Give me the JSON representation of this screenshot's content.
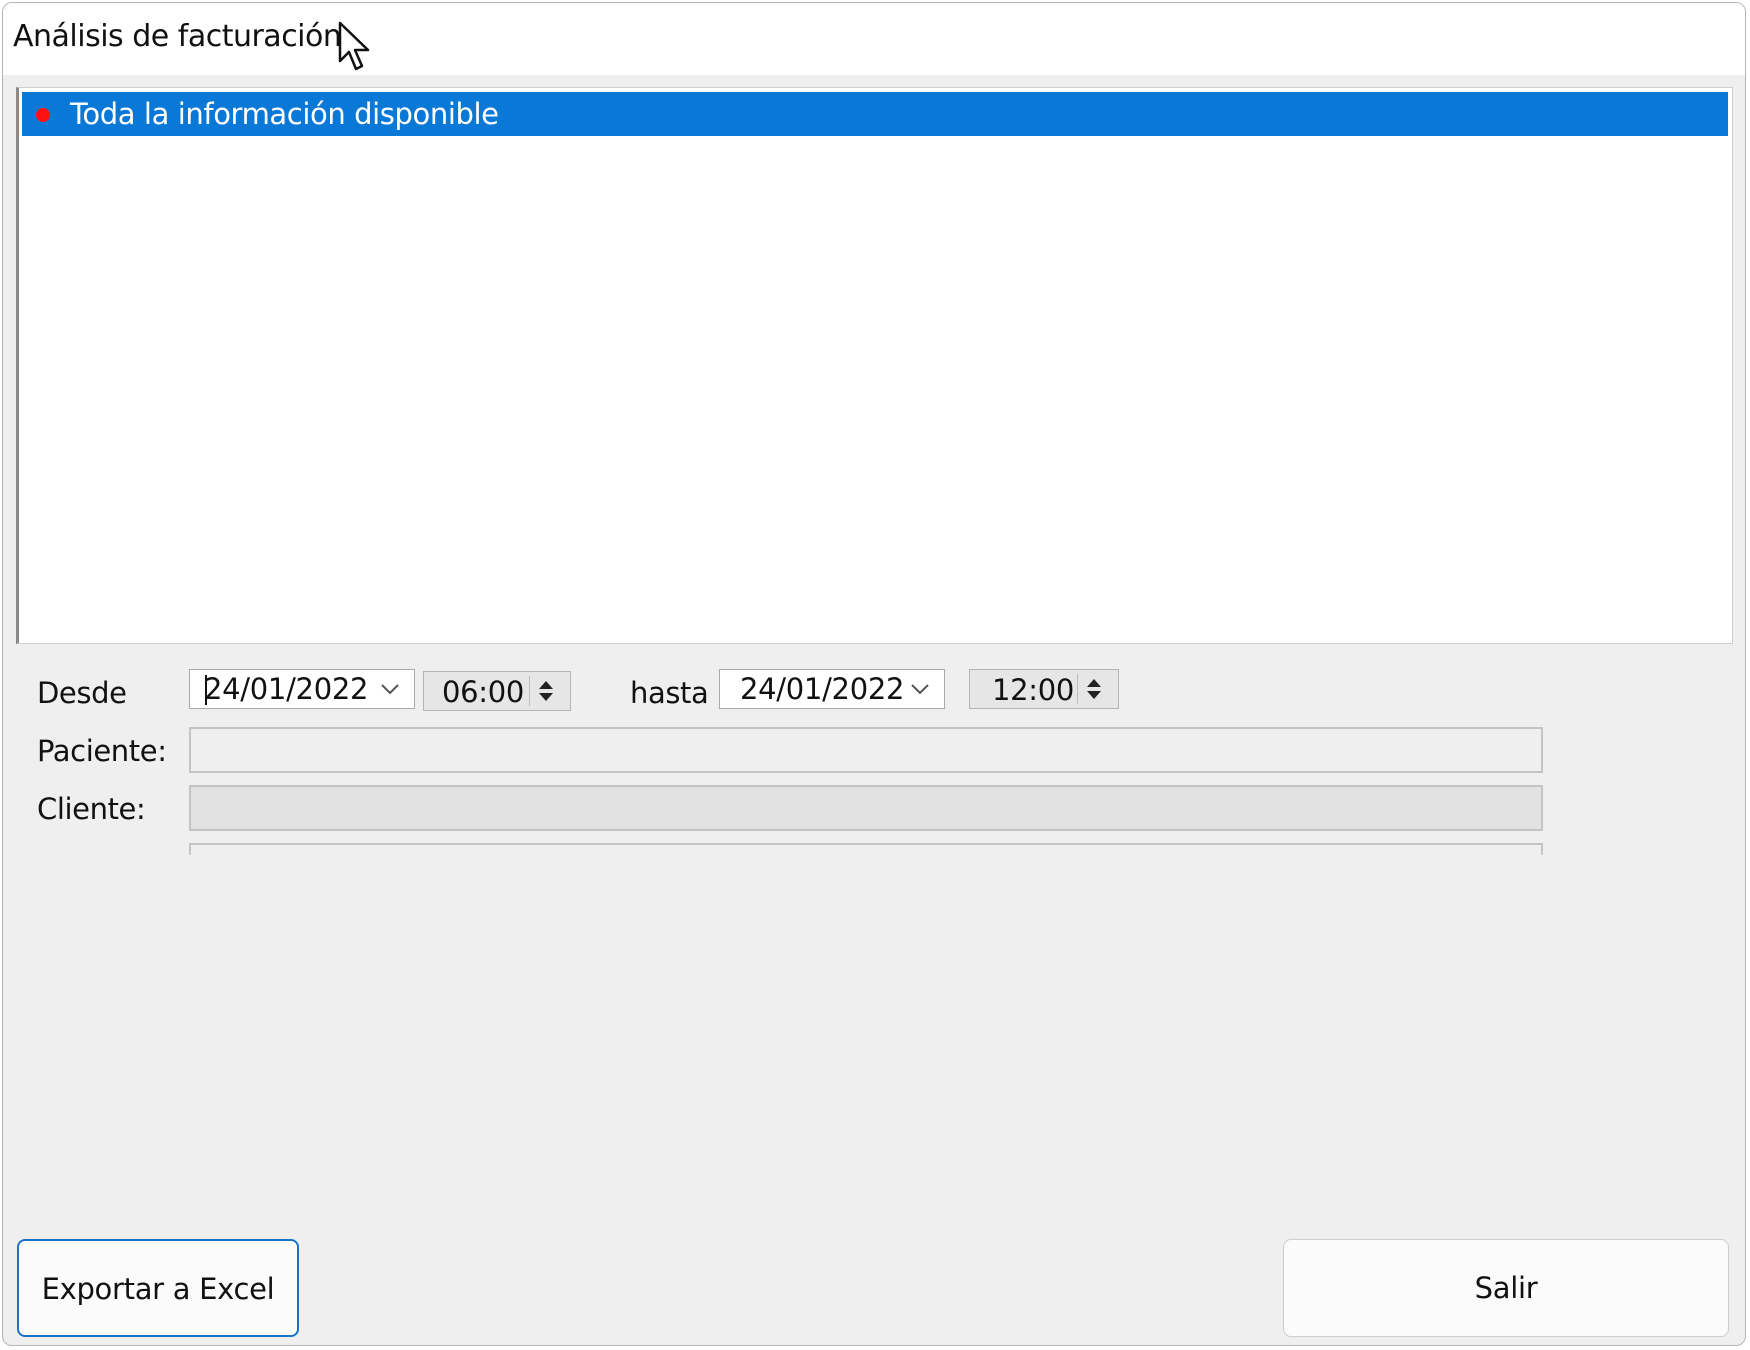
{
  "window": {
    "title": "Análisis de facturación"
  },
  "list": {
    "items": [
      {
        "label": "Toda la información disponible",
        "selected": true,
        "bullet_color": "#ff1010"
      }
    ],
    "selection_color": "#0a78d6"
  },
  "filters": {
    "desde_label": "Desde",
    "desde_date": "24/01/2022",
    "desde_time": "06:00",
    "hasta_label": "hasta",
    "hasta_date": "24/01/2022",
    "hasta_time": "12:00",
    "paciente_label": "Paciente:",
    "paciente_value": "",
    "cliente_label": "Cliente:",
    "cliente_value": ""
  },
  "buttons": {
    "export_label": "Exportar a Excel",
    "exit_label": "Salir",
    "focus_color": "#1a73c9"
  }
}
